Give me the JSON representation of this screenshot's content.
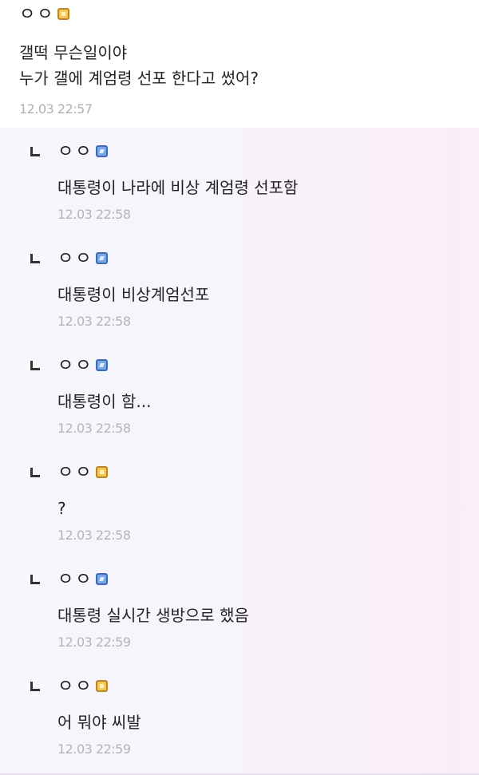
{
  "main_comment": {
    "nickname": "ㅇㅇ",
    "badge_icon": "gold-nickname-icon",
    "lines": [
      "갤떡 무슨일이야",
      "누가 갤에 계엄령 선포 한다고 썼어?"
    ],
    "timestamp": "12.03 22:57"
  },
  "replies": [
    {
      "nickname": "ㅇㅇ",
      "badge_icon": "blue-nickname-icon",
      "text": "대통령이 나라에 비상 계엄령 선포함",
      "timestamp": "12.03 22:58"
    },
    {
      "nickname": "ㅇㅇ",
      "badge_icon": "blue-nickname-icon",
      "text": "대통령이 비상계엄선포",
      "timestamp": "12.03 22:58"
    },
    {
      "nickname": "ㅇㅇ",
      "badge_icon": "blue-nickname-icon",
      "text": "대통령이 함...",
      "timestamp": "12.03 22:58"
    },
    {
      "nickname": "ㅇㅇ",
      "badge_icon": "gold-nickname-icon",
      "text": "?",
      "timestamp": "12.03 22:58"
    },
    {
      "nickname": "ㅇㅇ",
      "badge_icon": "blue-nickname-icon",
      "text": "대통령 실시간 생방으로 했음",
      "timestamp": "12.03 22:59"
    },
    {
      "nickname": "ㅇㅇ",
      "badge_icon": "gold-nickname-icon",
      "text": "어 뭐야 씨발",
      "timestamp": "12.03 22:59"
    }
  ],
  "colors": {
    "gold_badge": "#f3c95a",
    "blue_badge": "#7aa8e6",
    "timestamp": "#b0b0b0",
    "reply_bg_left": "#f6f6fb",
    "reply_bg_right": "#fbeef6"
  }
}
